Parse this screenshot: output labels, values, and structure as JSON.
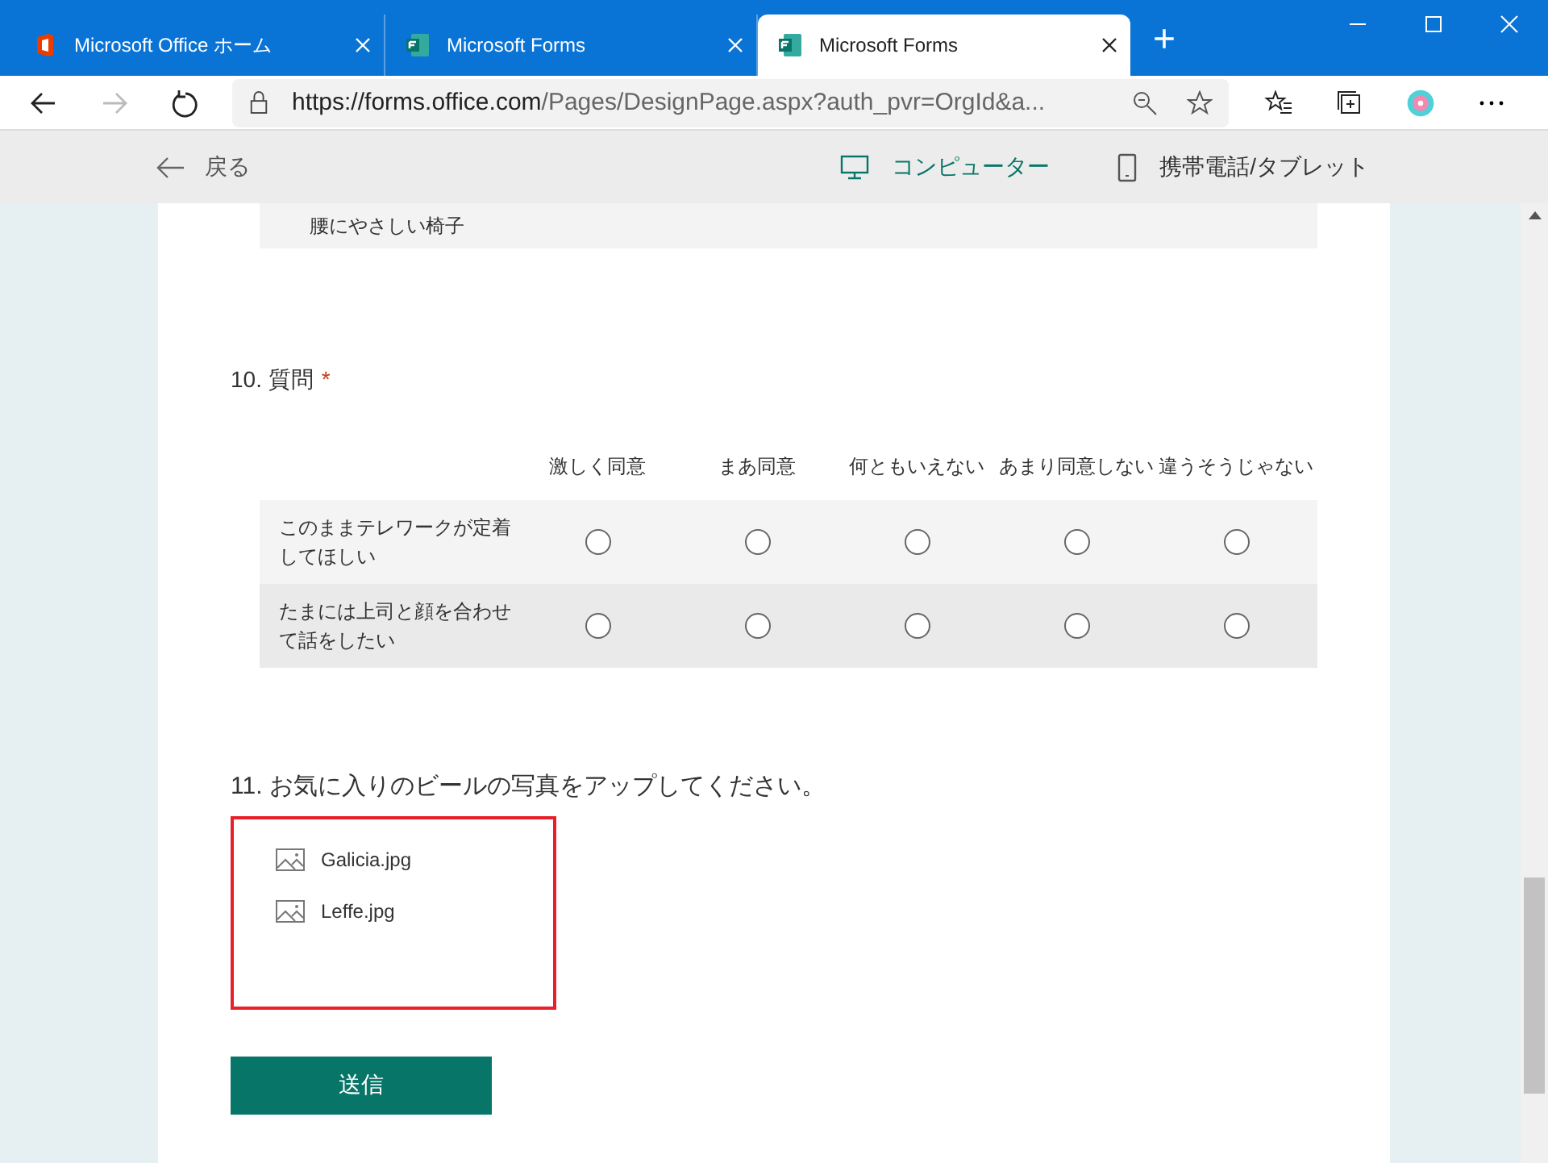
{
  "browser": {
    "tabs": [
      {
        "title": "Microsoft Office ホーム",
        "kind": "office",
        "selected": false
      },
      {
        "title": "Microsoft Forms",
        "kind": "forms",
        "selected": false
      },
      {
        "title": "Microsoft Forms",
        "kind": "forms",
        "selected": true
      }
    ],
    "new_tab": "+",
    "address": {
      "host": "https://forms.office.com",
      "path": "/Pages/DesignPage.aspx?auth_pvr=OrgId&a..."
    }
  },
  "preview_bar": {
    "back": "戻る",
    "devices": [
      {
        "label": "コンピューター",
        "kind": "computer",
        "selected": true
      },
      {
        "label": "携帯電話/タブレット",
        "kind": "phone",
        "selected": false
      }
    ]
  },
  "previous_option": "腰にやさしい椅子",
  "question10": {
    "number": "10.",
    "title": "質問",
    "required_mark": "*",
    "columns": [
      "激しく同意",
      "まあ同意",
      "何ともいえない",
      "あまり同意しない",
      "違うそうじゃない"
    ],
    "rows": [
      {
        "label": "このままテレワークが定着してほしい",
        "choices": [
          {
            "selected": false
          },
          {
            "selected": false
          },
          {
            "selected": false
          },
          {
            "selected": false
          },
          {
            "selected": false
          }
        ]
      },
      {
        "label": "たまには上司と顔を合わせて話をしたい",
        "choices": [
          {
            "selected": false
          },
          {
            "selected": false
          },
          {
            "selected": false
          },
          {
            "selected": false
          },
          {
            "selected": false
          }
        ]
      }
    ]
  },
  "question11": {
    "number": "11.",
    "title": "お気に入りのビールの写真をアップしてください。",
    "highlighted": true,
    "files": [
      "Galicia.jpg",
      "Leffe.jpg"
    ]
  },
  "submit": "送信"
}
